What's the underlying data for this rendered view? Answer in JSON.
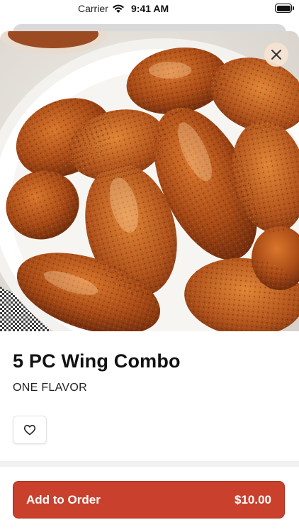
{
  "status_bar": {
    "carrier": "Carrier",
    "time": "9:41 AM",
    "wifi_icon": "wifi-icon",
    "battery_icon": "battery-icon"
  },
  "item": {
    "title": "5 PC Wing Combo",
    "subtitle": "ONE FLAVOR",
    "image": "chicken wings on a white plate"
  },
  "actions": {
    "close_icon": "close-icon",
    "favorite_icon": "heart-outline-icon",
    "add_to_order_label": "Add to Order",
    "price": "$10.00"
  },
  "colors": {
    "accent": "#c9402c",
    "close_button_bg": "#f5e4d2"
  }
}
